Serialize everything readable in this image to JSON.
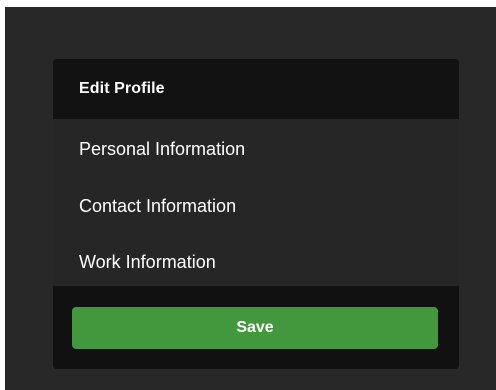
{
  "panel": {
    "title": "Edit Profile"
  },
  "menu": {
    "items": [
      {
        "label": "Personal Information"
      },
      {
        "label": "Contact Information"
      },
      {
        "label": "Work Information"
      }
    ]
  },
  "footer": {
    "save_label": "Save"
  },
  "colors": {
    "background": "#282828",
    "panel": "#111111",
    "menu": "#262626",
    "accent": "#43983e",
    "text": "#ffffff"
  }
}
